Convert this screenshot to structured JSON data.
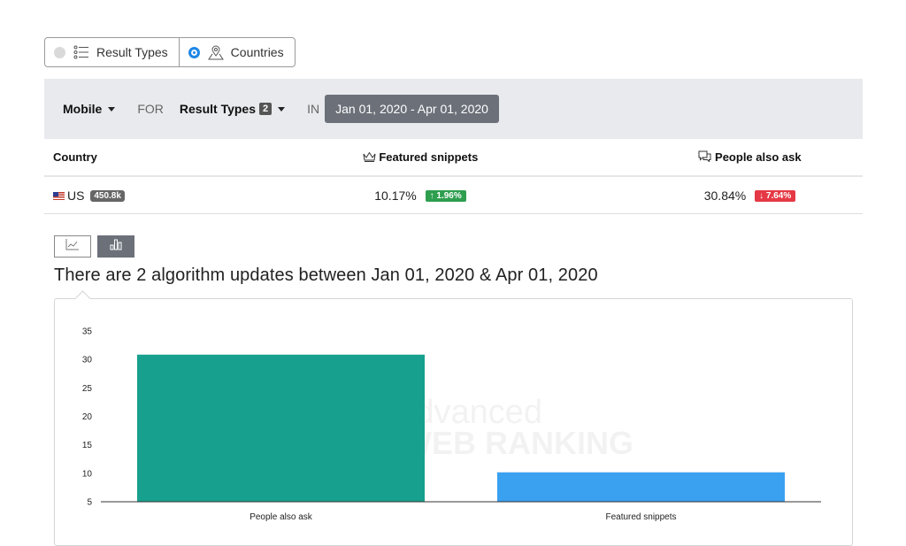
{
  "toggle": {
    "result_types_label": "Result Types",
    "countries_label": "Countries",
    "selected": "countries"
  },
  "filter": {
    "device": "Mobile",
    "for_label": "FOR",
    "result_types": "Result Types",
    "result_types_count": "2",
    "in_label": "IN",
    "date_range": "Jan 01, 2020 - Apr 01, 2020"
  },
  "table": {
    "headers": {
      "country": "Country",
      "featured": "Featured snippets",
      "paa": "People also ask"
    },
    "rows": [
      {
        "country": "US",
        "volume": "450.8k",
        "featured_value": "10.17%",
        "featured_change": "↑ 1.96%",
        "paa_value": "30.84%",
        "paa_change": "↓ 7.64%"
      }
    ]
  },
  "updates_title": "There are 2 algorithm updates between Jan 01, 2020 & Apr 01, 2020",
  "colors": {
    "paa_bar": "#17a08e",
    "featured_bar": "#3aa0f0",
    "up": "#2e9e4f",
    "down": "#e53945"
  },
  "icons": [
    "list-icon",
    "location-pin-icon",
    "crown-icon",
    "chat-bubbles-icon",
    "line-chart-icon",
    "bar-chart-icon"
  ],
  "watermark": "Advanced WEB RANKING",
  "chart_data": {
    "type": "bar",
    "categories": [
      "People also ask",
      "Featured snippets"
    ],
    "values": [
      30.84,
      10.17
    ],
    "colors": [
      "#17a08e",
      "#3aa0f0"
    ],
    "yticks": [
      5,
      10,
      15,
      20,
      25,
      30,
      35
    ],
    "ylim": [
      5,
      35
    ],
    "title": "",
    "xlabel": "",
    "ylabel": ""
  }
}
